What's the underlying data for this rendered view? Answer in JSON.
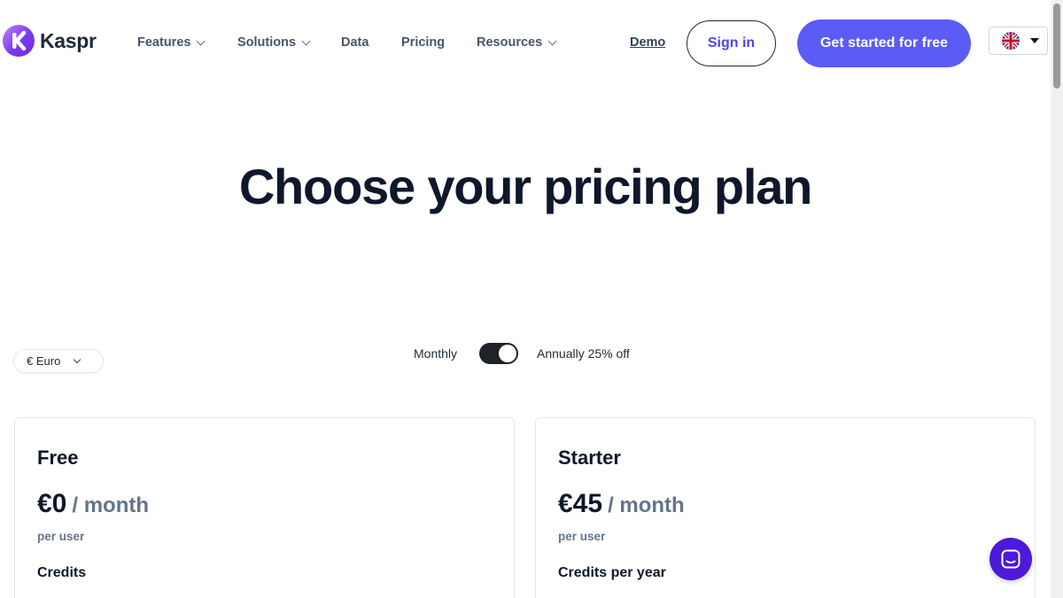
{
  "brand": {
    "name": "Kaspr"
  },
  "nav": {
    "items": [
      {
        "label": "Features",
        "has_dropdown": true
      },
      {
        "label": "Solutions",
        "has_dropdown": true
      },
      {
        "label": "Data",
        "has_dropdown": false
      },
      {
        "label": "Pricing",
        "has_dropdown": false
      },
      {
        "label": "Resources",
        "has_dropdown": true
      }
    ],
    "demo": "Demo",
    "sign_in": "Sign in",
    "cta": "Get started for free",
    "language_icon": "uk-flag-icon"
  },
  "hero": {
    "title": "Choose your pricing plan"
  },
  "controls": {
    "currency": "€ Euro",
    "billing_monthly": "Monthly",
    "billing_annual": "Annually 25% off",
    "annual_selected": true
  },
  "plans": [
    {
      "name": "Free",
      "price": "€0",
      "period": "/ month",
      "per_user": "per user",
      "credits_label": "Credits"
    },
    {
      "name": "Starter",
      "price": "€45",
      "period": "/ month",
      "per_user": "per user",
      "credits_label": "Credits per year"
    }
  ],
  "colors": {
    "accent": "#5b5bf6",
    "text_dark": "#0f172a",
    "muted": "#64748b",
    "chat": "#4c1ad8"
  }
}
